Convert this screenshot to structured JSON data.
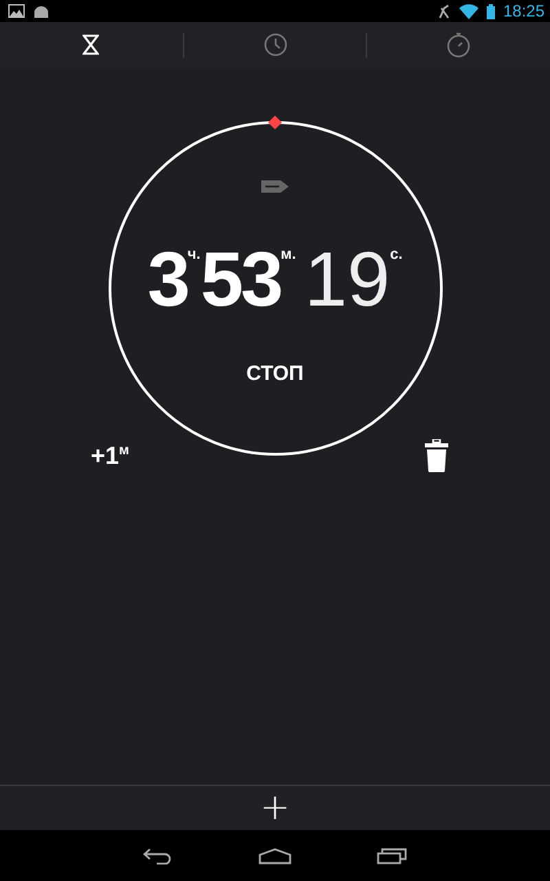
{
  "status_bar": {
    "time": "18:25"
  },
  "tabs": [
    {
      "kind": "timer",
      "selected": true
    },
    {
      "kind": "clock",
      "selected": false
    },
    {
      "kind": "stopwatch",
      "selected": false
    }
  ],
  "timer": {
    "hours": "3",
    "hours_unit": "ч.",
    "minutes": "53",
    "minutes_unit": "м.",
    "seconds": "19",
    "seconds_unit": "с.",
    "stop_button": "СТОП",
    "add_minute": "+1",
    "add_minute_unit": "м"
  },
  "footer": {
    "add_button": "+"
  }
}
